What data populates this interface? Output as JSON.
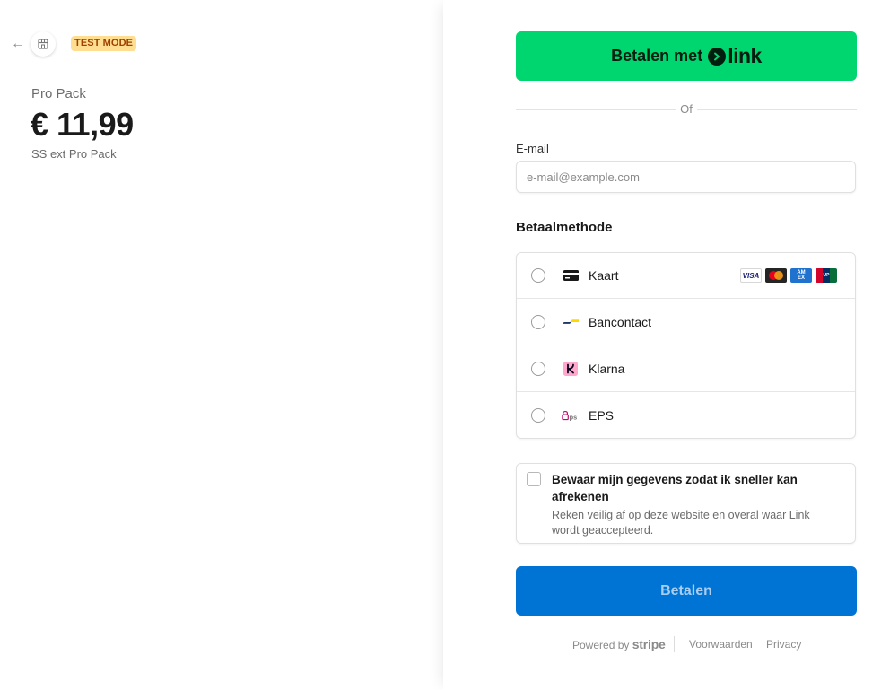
{
  "header": {
    "back_icon": "arrow-left-icon",
    "store_icon": "storefront-icon",
    "badge": "TEST MODE"
  },
  "product": {
    "name": "Pro Pack",
    "price": "€ 11,99",
    "description": "SS ext Pro Pack"
  },
  "link_button": {
    "label": "Betalen met",
    "logo_text": "link"
  },
  "divider": {
    "text": "Of"
  },
  "email": {
    "label": "E-mail",
    "placeholder": "e-mail@example.com",
    "value": ""
  },
  "payment_methods": {
    "title": "Betaalmethode",
    "options": [
      {
        "label": "Kaart",
        "icon": "card-icon",
        "selected": false,
        "brands": [
          "VISA",
          "Mastercard",
          "AMEX",
          "UnionPay"
        ]
      },
      {
        "label": "Bancontact",
        "icon": "bancontact-icon",
        "selected": false
      },
      {
        "label": "Klarna",
        "icon": "klarna-icon",
        "selected": false
      },
      {
        "label": "EPS",
        "icon": "eps-icon",
        "selected": false
      }
    ]
  },
  "save_info": {
    "checked": false,
    "title": "Bewaar mijn gegevens zodat ik sneller kan afrekenen",
    "subtitle": "Reken veilig af op deze website en overal waar Link wordt geaccepteerd."
  },
  "pay_button": {
    "label": "Betalen"
  },
  "footer": {
    "powered_by": "Powered by",
    "brand": "stripe",
    "terms": "Voorwaarden",
    "privacy": "Privacy"
  },
  "colors": {
    "link_green": "#00d66f",
    "pay_blue": "#0074d4",
    "badge_bg": "#ffde92",
    "badge_text": "#a04100"
  }
}
